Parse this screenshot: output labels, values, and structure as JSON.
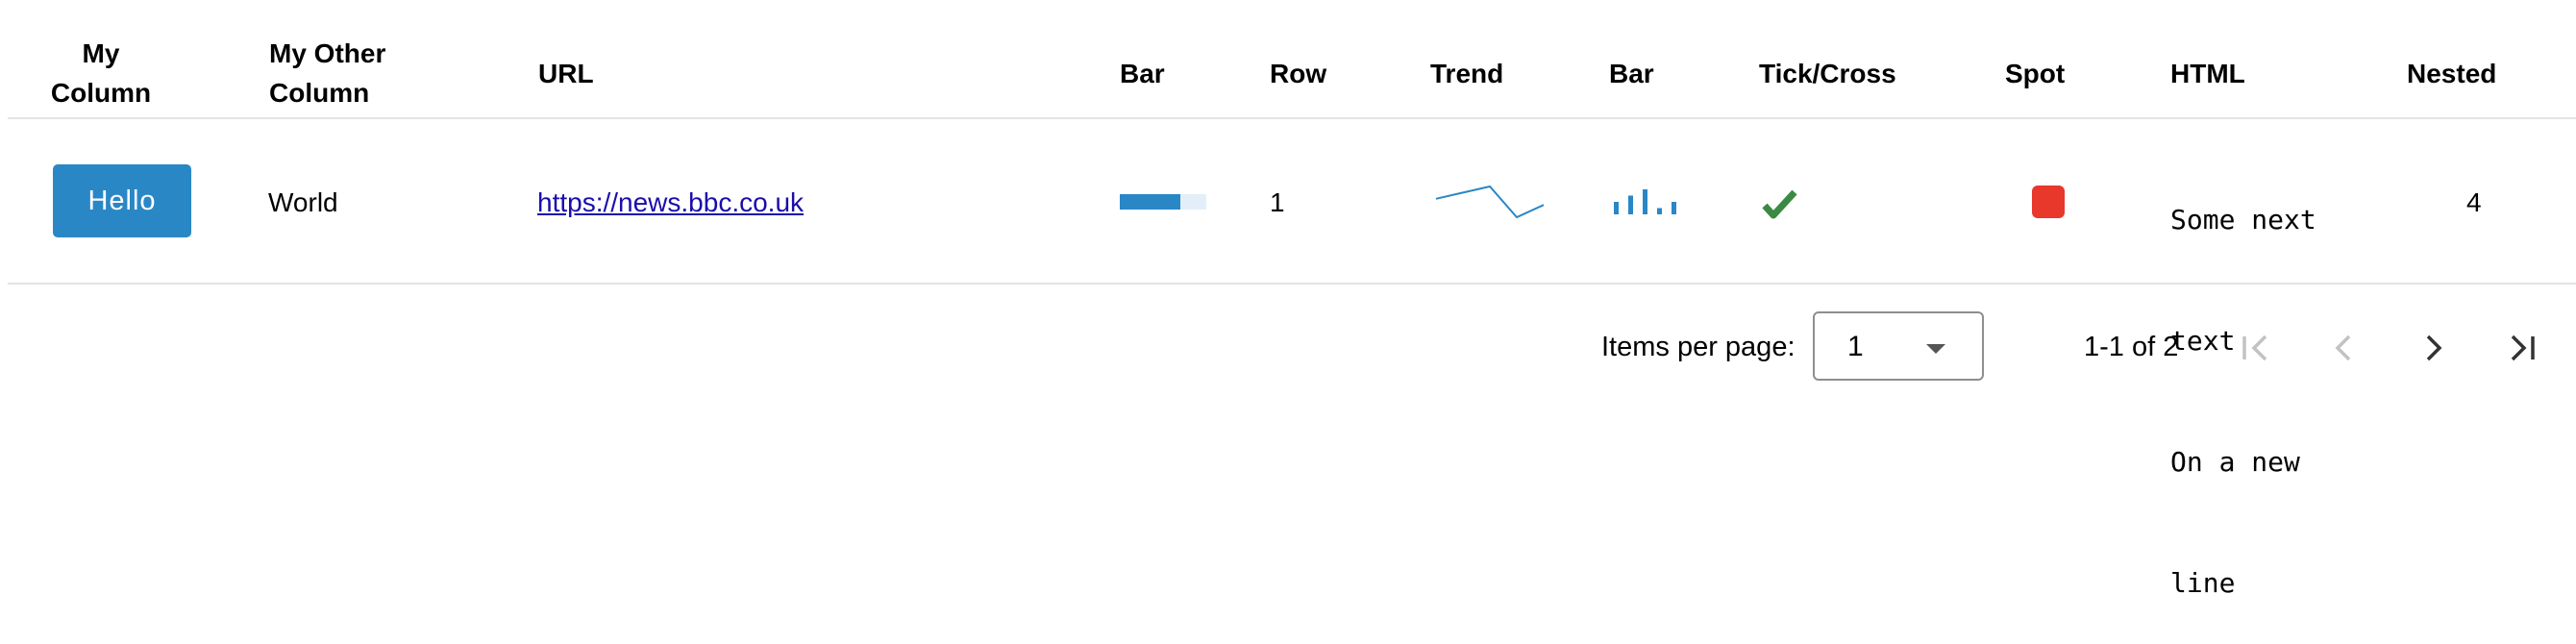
{
  "table": {
    "headers": {
      "my_column_line1": "My",
      "my_column_line2": "Column",
      "my_other_column_line1": "My Other",
      "my_other_column_line2": "Column",
      "url": "URL",
      "bar": "Bar",
      "row": "Row",
      "trend": "Trend",
      "bar2": "Bar",
      "tick_cross": "Tick/Cross",
      "spot": "Spot",
      "html": "HTML",
      "nested": "Nested"
    },
    "row": {
      "button_label": "Hello",
      "other": "World",
      "url": "https://news.bbc.co.uk",
      "bar_progress_fraction": 0.7,
      "row_number": "1",
      "trend_values": [
        3,
        4,
        5,
        0,
        2
      ],
      "bar_values": [
        2,
        3,
        4,
        1,
        2
      ],
      "tick": true,
      "spot_color": "#e8372b",
      "html_lines": [
        "Some next",
        "text",
        "On a new",
        "line"
      ],
      "nested": "4"
    },
    "colors": {
      "accent": "#2a87c6",
      "tick": "#3b8a43",
      "spot": "#e8372b"
    }
  },
  "paginator": {
    "items_per_page_label": "Items per page:",
    "page_size_value": "1",
    "range_label": "1-1 of 2",
    "first_icon": "first-page-icon",
    "prev_icon": "chevron-left-icon",
    "next_icon": "chevron-right-icon",
    "last_icon": "last-page-icon"
  }
}
